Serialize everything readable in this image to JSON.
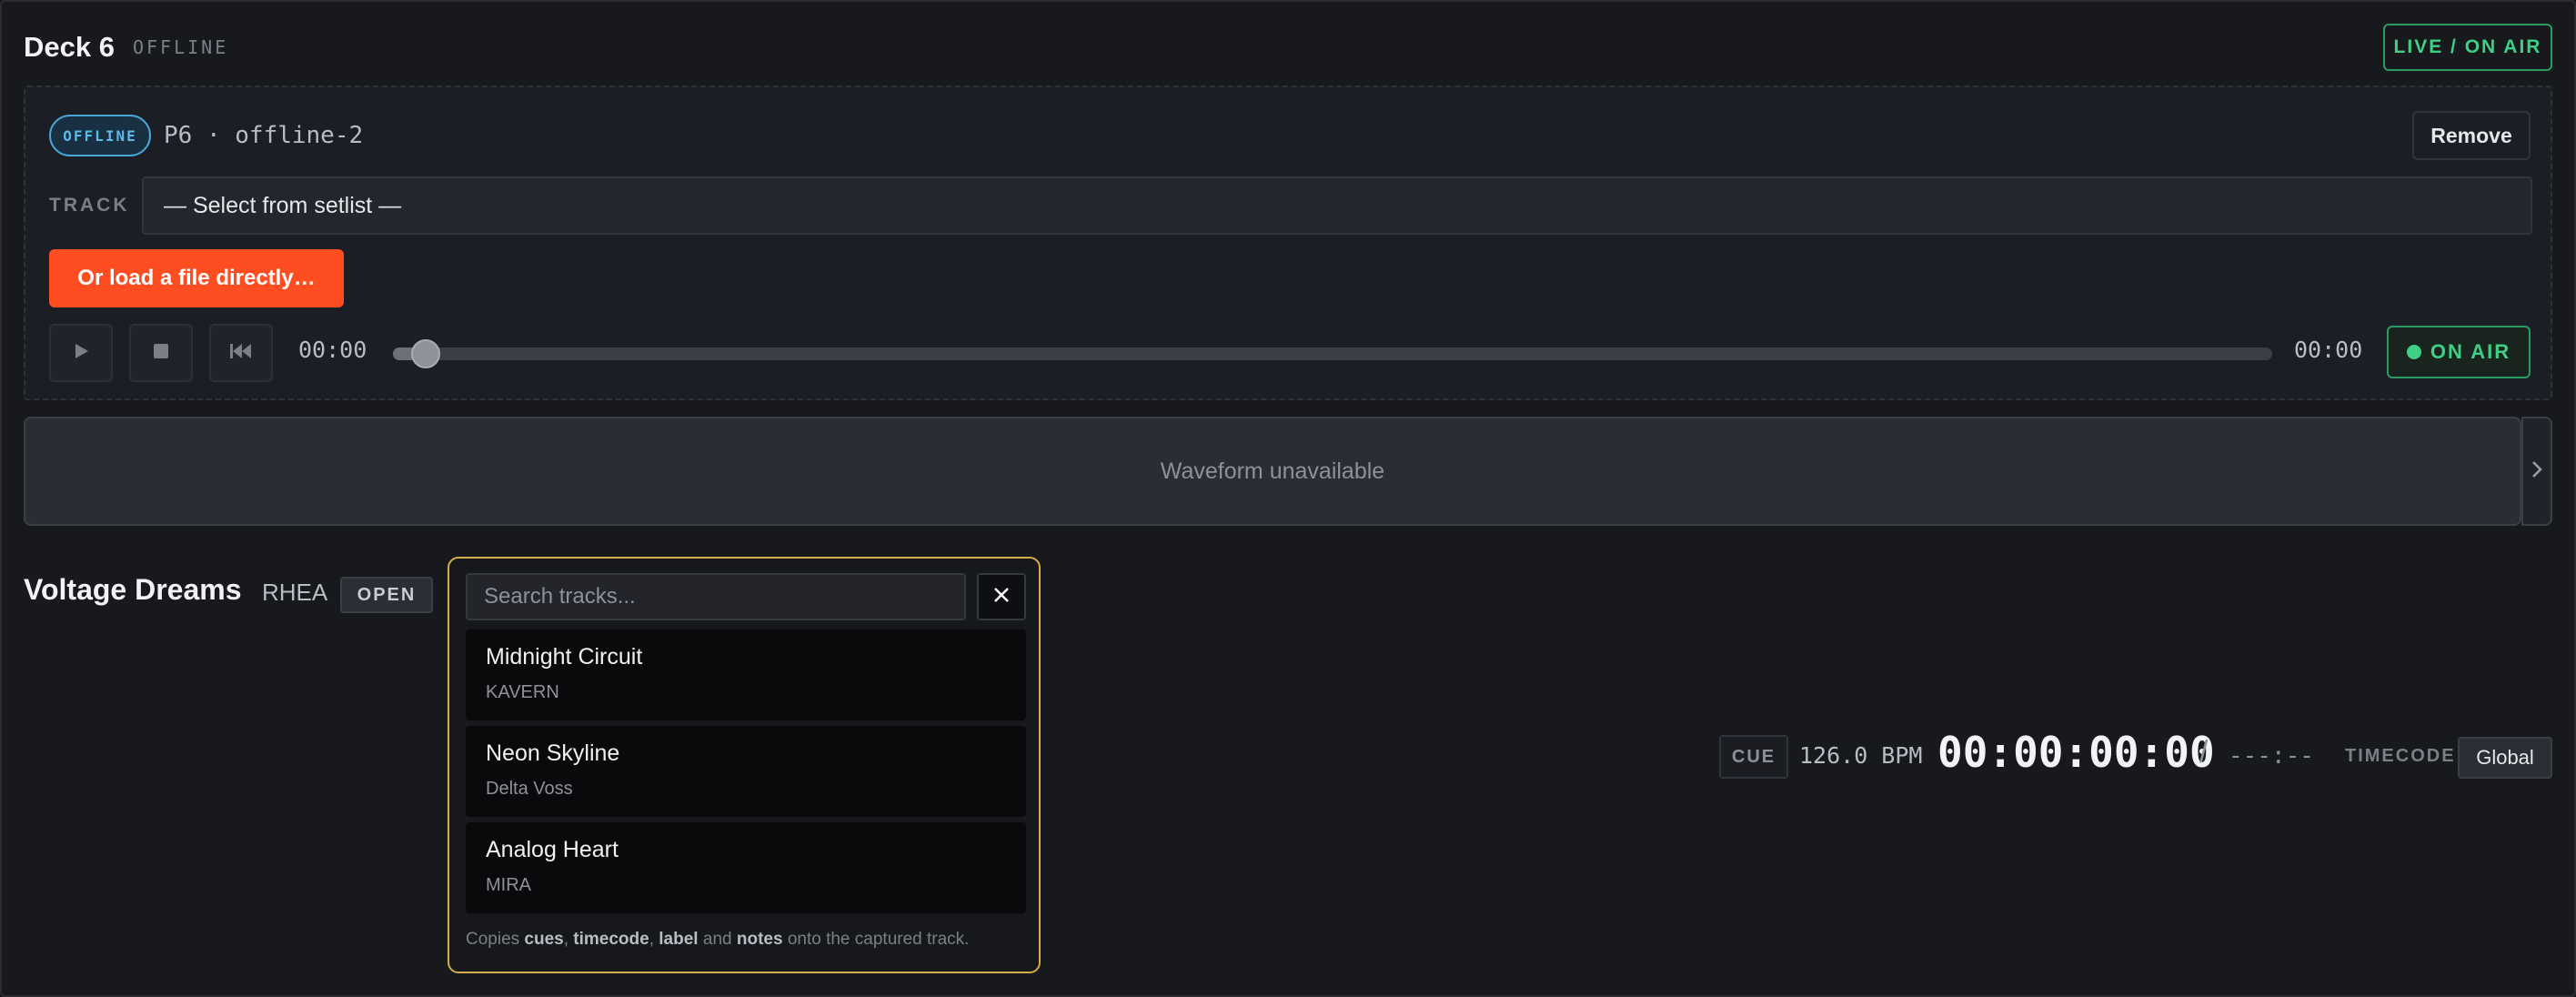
{
  "deck": {
    "title": "Deck 6",
    "status": "OFFLINE",
    "live_label": "LIVE / ON AIR"
  },
  "player": {
    "badge": "OFFLINE",
    "id_label": "P6 · offline-2",
    "remove_label": "Remove",
    "track_label": "TRACK",
    "track_select_value": "— Select from setlist —",
    "load_label": "Or load a file directly…",
    "elapsed": "00:00",
    "duration": "00:00",
    "progress": 0,
    "onair_label": "ON AIR",
    "controls": [
      "play-icon",
      "stop-icon",
      "skip-back-icon"
    ]
  },
  "waveform": {
    "message": "Waveform unavailable"
  },
  "song": {
    "title": "Voltage Dreams",
    "artist": "RHEA",
    "state": "OPEN"
  },
  "search": {
    "placeholder": "Search tracks...",
    "results": [
      {
        "title": "Midnight Circuit",
        "artist": "KAVERN"
      },
      {
        "title": "Neon Skyline",
        "artist": "Delta Voss"
      },
      {
        "title": "Analog Heart",
        "artist": "MIRA"
      }
    ],
    "note": {
      "prefix": "Copies ",
      "w1": "cues",
      "sep1": ", ",
      "w2": "timecode",
      "sep2": ", ",
      "w3": "label",
      "sep3": " and ",
      "w4": "notes",
      "suffix": " onto the captured track."
    }
  },
  "timecode": {
    "cue_label": "CUE",
    "bpm": "126.0 BPM",
    "value": "00:00:00:00",
    "separator": "/",
    "duration": "---:--",
    "label": "TIMECODE",
    "mode": "Global"
  },
  "colors": {
    "accent_orange": "#ff4d22",
    "on_air_green": "#3fcf85",
    "offline_blue": "#5fb9e8",
    "popover_gold": "#d6ac4a"
  }
}
